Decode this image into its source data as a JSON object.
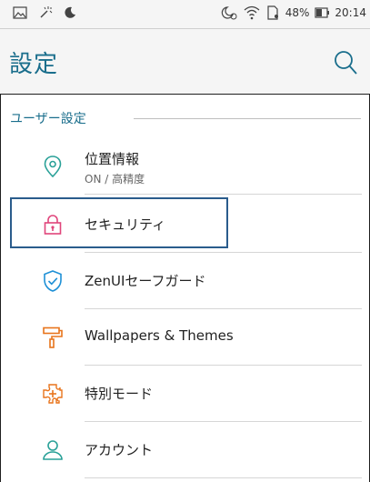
{
  "status_bar": {
    "battery_percent": "48%",
    "time": "20:14"
  },
  "header": {
    "title": "設定"
  },
  "section": {
    "label": "ユーザー設定"
  },
  "items": [
    {
      "label": "位置情報",
      "sublabel": "ON / 高精度",
      "icon": "location-pin-icon",
      "color": "#2aa198"
    },
    {
      "label": "セキュリティ",
      "sublabel": "",
      "icon": "lock-icon",
      "color": "#e0457b"
    },
    {
      "label": "ZenUIセーフガード",
      "sublabel": "",
      "icon": "shield-check-icon",
      "color": "#1e90d6"
    },
    {
      "label": "Wallpapers & Themes",
      "sublabel": "",
      "icon": "paint-roller-icon",
      "color": "#e8741c"
    },
    {
      "label": "特別モード",
      "sublabel": "",
      "icon": "puzzle-plus-icon",
      "color": "#e8741c"
    },
    {
      "label": "アカウント",
      "sublabel": "",
      "icon": "person-icon",
      "color": "#2aa198"
    }
  ],
  "colors": {
    "accent": "#1a6e8c",
    "selection_border": "#2a5c8c"
  }
}
